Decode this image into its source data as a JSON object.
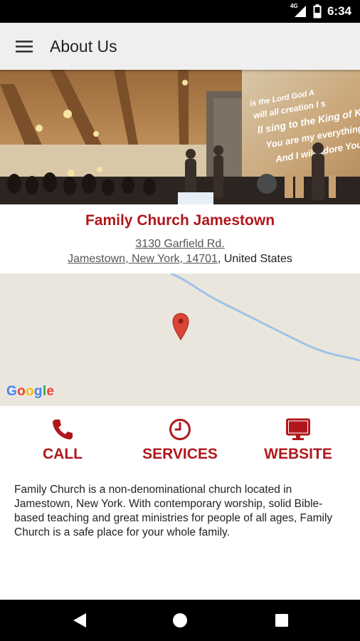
{
  "status_bar": {
    "time": "6:34",
    "network": "4G"
  },
  "app_bar": {
    "title": "About Us",
    "menu_icon": "hamburger-menu-icon"
  },
  "hero": {
    "overlay_text": [
      "is the Lord God A",
      "will all creation I s",
      "ll sing to the King of Kin",
      "You are my everything",
      "And I will adore You."
    ]
  },
  "church": {
    "name": "Family Church Jamestown",
    "address_line1": "3130 Garfield Rd.",
    "address_city": "Jamestown, New York, 14701",
    "address_country": ", United States"
  },
  "map": {
    "provider": "Google",
    "pin_color": "#db4437"
  },
  "actions": [
    {
      "label": "CALL",
      "icon": "phone-icon"
    },
    {
      "label": "SERVICES",
      "icon": "clock-icon"
    },
    {
      "label": "WEBSITE",
      "icon": "monitor-icon"
    }
  ],
  "description": "Family Church is a non-denominational church located in Jamestown, New York. With contemporary worship, solid Bible-based teaching and great ministries for people of all ages, Family Church is a safe place for your whole family.",
  "nav_bar": {
    "back_icon": "back-triangle-icon",
    "home_icon": "home-circle-icon",
    "recents_icon": "recents-square-icon"
  },
  "colors": {
    "accent": "#b0171c",
    "app_bar_bg": "#efefef",
    "map_bg": "#ebe6dd"
  }
}
